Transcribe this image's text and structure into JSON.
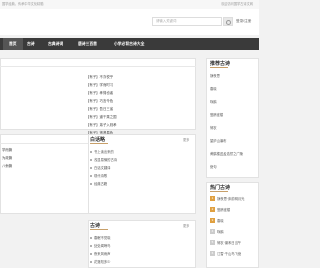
{
  "topbar": {
    "left_text": "国学经典，传承中华文化精髓",
    "right_text": "欢迎访问国学古诗文网"
  },
  "search": {
    "placeholder": "请输入关键词",
    "login": "登录/注册"
  },
  "nav": {
    "items": [
      "首页",
      "古诗",
      "古典诗词",
      "唐诗三百首",
      "小学必背古诗大全"
    ]
  },
  "poems": {
    "items": [
      "【有子】不亦悦乎",
      "【有子】学而时习",
      "【有子】孝悌也者",
      "【有子】巧言令色",
      "【有子】吾日三省",
      "【有子】道千乘之国",
      "【有子】弟子入则孝",
      "【有子】贤贤易色",
      "【有子】君子不重",
      "【有子】慎终追远",
      "【有子】夫子至于是邦",
      "【有子】父在观其志",
      "【有子】礼之用"
    ]
  },
  "sidebar1": {
    "title": "推荐古诗",
    "items": [
      "静夜思",
      "春晓",
      "咏鹅",
      "登鹳雀楼",
      "悯农",
      "望庐山瀑布",
      "黄鹤楼送孟浩然之广陵",
      "绝句"
    ]
  },
  "section_ziyu": {
    "title": "白话略",
    "more": "更多",
    "items": [
      "书上读出来的",
      "浅显易懂的古诗",
      "白话文翻译",
      "现代诗歌",
      "经典古籍"
    ]
  },
  "left_mid": {
    "more": "更多",
    "items": [
      "学而篇",
      "为政篇",
      "八佾篇"
    ]
  },
  "section_gushi": {
    "title": "古诗",
    "more": "更多",
    "items": [
      "春眠不觉晓",
      "处处闻啼鸟",
      "夜来风雨声",
      "花落知多少"
    ]
  },
  "sidebar2": {
    "title": "热门古诗",
    "ranks": [
      "1",
      "2",
      "3",
      "4",
      "5",
      "6"
    ],
    "items": [
      "静夜思·床前明月光",
      "登鹳雀楼",
      "春晓",
      "咏鹅",
      "悯农·锄禾日当午",
      "江雪·千山鸟飞绝"
    ]
  },
  "colors": {
    "nav_bg": "#3a3a3a",
    "accent": "#c8a06a",
    "hot": "#e0a040"
  }
}
